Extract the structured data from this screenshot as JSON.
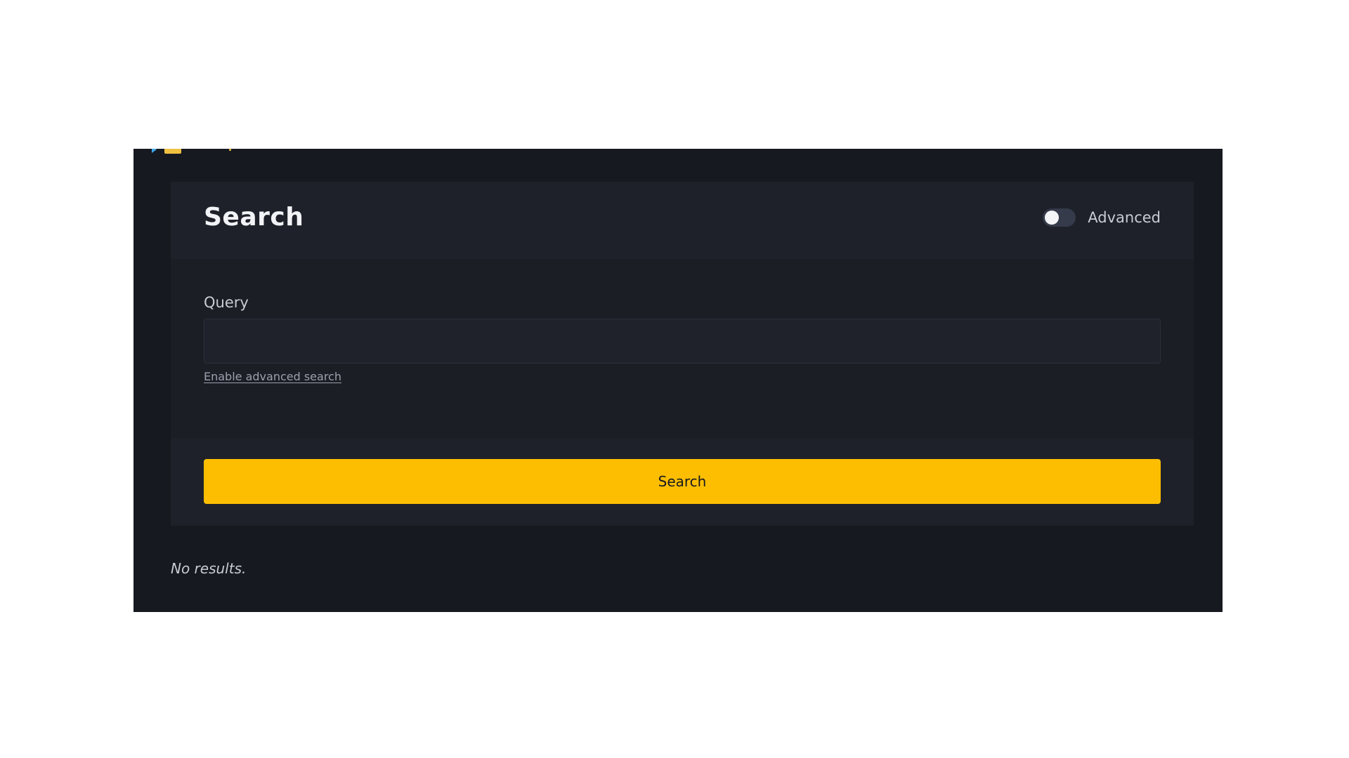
{
  "header": {
    "title": "Search",
    "advanced_toggle": {
      "label": "Advanced",
      "enabled": false
    }
  },
  "form": {
    "query_label": "Query",
    "query_value": "",
    "query_placeholder": "",
    "advanced_link": "Enable advanced search",
    "submit_label": "Search"
  },
  "results": {
    "empty_message": "No results."
  },
  "colors": {
    "page_background": "#161920",
    "card_background": "#1b1e25",
    "accent": "#fdbe02",
    "text_primary": "#f1f3f6",
    "text_secondary": "#c9ccd4",
    "link": "#9aa0ad"
  }
}
